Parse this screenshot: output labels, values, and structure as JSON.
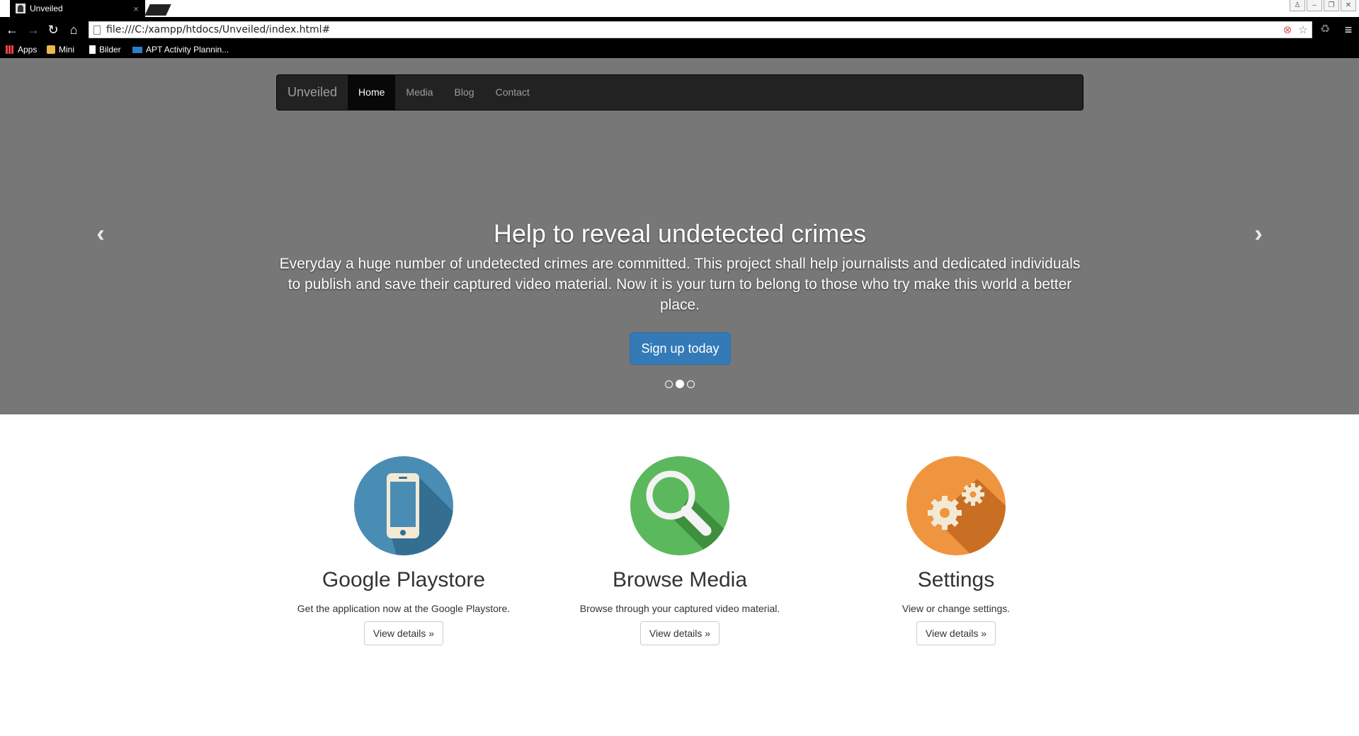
{
  "browser": {
    "tab_title": "Unveiled",
    "tab_close": "×",
    "url": "file:///C:/xampp/htdocs/Unveiled/index.html#",
    "bookmarks": [
      {
        "label": "Apps",
        "icon": "apps-grid-icon"
      },
      {
        "label": "Mini",
        "icon": "folder-icon"
      },
      {
        "label": "Bilder",
        "icon": "page-icon"
      },
      {
        "label": "APT Activity Plannin...",
        "icon": "sap-icon"
      }
    ]
  },
  "navbar": {
    "brand": "Unveiled",
    "links": [
      {
        "label": "Home",
        "active": true
      },
      {
        "label": "Media",
        "active": false
      },
      {
        "label": "Blog",
        "active": false
      },
      {
        "label": "Contact",
        "active": false
      }
    ]
  },
  "hero": {
    "title": "Help to reveal undetected crimes",
    "text": "Everyday a huge number of undetected crimes are committed. This project shall help journalists and dedicated individuals to publish and save their captured video material. Now it is your turn to belong to those who try make this world a better place.",
    "cta": "Sign up today",
    "slides": 3,
    "active_slide": 2
  },
  "features": [
    {
      "title": "Google Playstore",
      "text": "Get the application now at the Google Playstore.",
      "button": "View details »",
      "icon": "smartphone-icon",
      "color": "#4a8db4"
    },
    {
      "title": "Browse Media",
      "text": "Browse through your captured video material.",
      "button": "View details »",
      "icon": "magnifier-icon",
      "color": "#5cb85c"
    },
    {
      "title": "Settings",
      "text": "View or change settings.",
      "button": "View details »",
      "icon": "gears-icon",
      "color": "#f0953f"
    }
  ]
}
